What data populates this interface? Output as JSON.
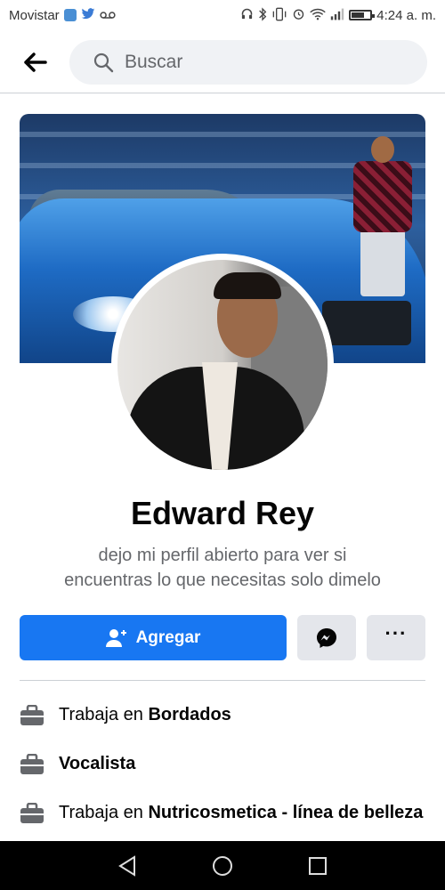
{
  "status_bar": {
    "carrier": "Movistar",
    "time": "4:24 a. m.",
    "indicators": [
      "facebook-icon",
      "twitter-icon",
      "voicemail-icon",
      "headphones-icon",
      "bluetooth-icon",
      "vibrate-icon",
      "alarm-icon",
      "wifi-icon",
      "signal-icon",
      "battery-icon"
    ]
  },
  "header": {
    "back_icon": "arrow-left-icon",
    "search": {
      "placeholder": "Buscar",
      "icon": "search-icon"
    }
  },
  "profile": {
    "name": "Edward Rey",
    "bio_line1": "dejo mi perfil abierto para ver si",
    "bio_line2": "encuentras lo que necesitas solo dimelo"
  },
  "actions": {
    "add_label": "Agregar",
    "add_icon": "add-friend-icon",
    "messenger_icon": "messenger-icon",
    "more_label": "···"
  },
  "info": [
    {
      "prefix": "Trabaja en ",
      "value": "Bordados",
      "icon": "briefcase-icon"
    },
    {
      "prefix": "",
      "value": "Vocalista",
      "icon": "briefcase-icon"
    },
    {
      "prefix": "Trabaja en ",
      "value": "Nutricosmetica - línea de belleza",
      "icon": "briefcase-icon"
    }
  ],
  "colors": {
    "accent": "#1877f2",
    "secondary_button": "#e4e6eb",
    "search_bg": "#f0f2f5",
    "muted_text": "#65676b"
  },
  "navbar": [
    "back-triangle-icon",
    "home-circle-icon",
    "recents-square-icon"
  ]
}
